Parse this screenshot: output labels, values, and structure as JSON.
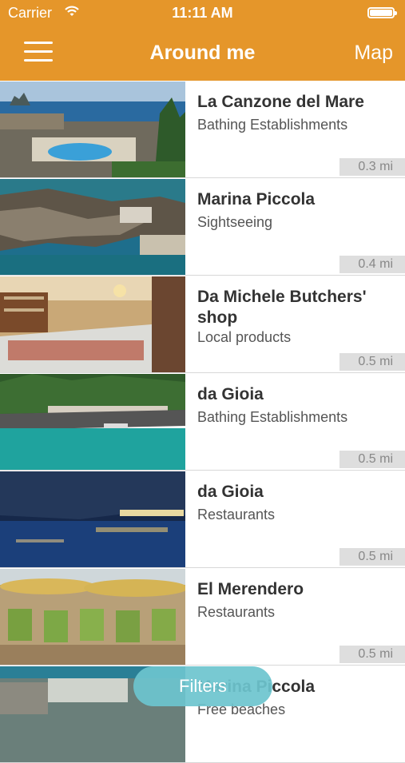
{
  "status_bar": {
    "carrier": "Carrier",
    "time": "11:11 AM",
    "wifi_icon": "wifi-icon",
    "battery_icon": "battery-icon"
  },
  "header": {
    "title": "Around me",
    "map_label": "Map",
    "menu_icon": "hamburger-menu-icon",
    "bg_color": "#e5962a"
  },
  "places": [
    {
      "name": "La Canzone del Mare",
      "category": "Bathing Establishments",
      "distance": "0.3 mi"
    },
    {
      "name": "Marina Piccola",
      "category": "Sightseeing",
      "distance": "0.4 mi"
    },
    {
      "name": "Da Michele Butchers' shop",
      "category": "Local products",
      "distance": "0.5 mi"
    },
    {
      "name": "da Gioia",
      "category": "Bathing Establishments",
      "distance": "0.5 mi"
    },
    {
      "name": "da Gioia",
      "category": "Restaurants",
      "distance": "0.5 mi"
    },
    {
      "name": "El Merendero",
      "category": "Restaurants",
      "distance": "0.5 mi"
    },
    {
      "name": "Marina Piccola",
      "category": "Free beaches",
      "distance": ""
    }
  ],
  "filters_button": {
    "label": "Filters",
    "color": "#6cc4ce"
  }
}
